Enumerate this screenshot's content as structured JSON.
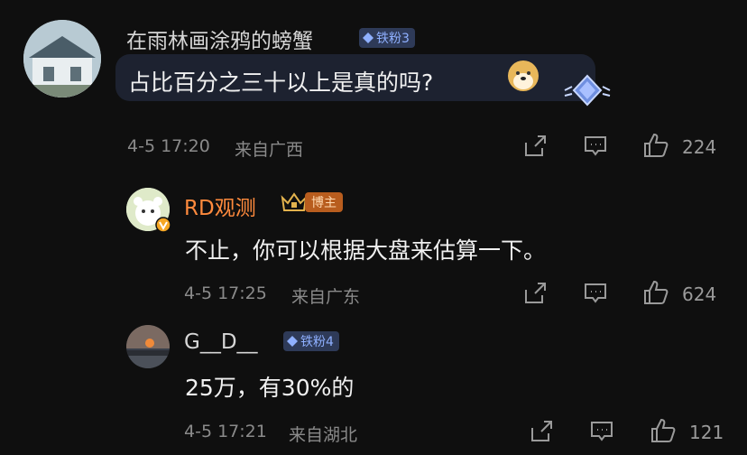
{
  "comments": [
    {
      "username": "在雨林画涂鸦的螃蟹",
      "fan_badge": "铁粉3",
      "text": "占比百分之三十以上是真的吗?",
      "time": "4-5 17:20",
      "location": "来自广西",
      "likes": "224"
    },
    {
      "username": "RD观测",
      "host_badge": "博主",
      "text": "不止，你可以根据大盘来估算一下。",
      "time": "4-5 17:25",
      "location": "来自广东",
      "likes": "624"
    },
    {
      "username": "G__D__",
      "fan_badge": "铁粉4",
      "text": "25万，有30%的",
      "time": "4-5 17:21",
      "location": "来自湖北",
      "likes": "121"
    }
  ],
  "colors": {
    "background": "#0f0f0f",
    "host_name": "#ff8a3d",
    "fan_badge": "#8fb0ff",
    "meta": "#8a8a8a"
  },
  "icons": [
    "share-icon",
    "comment-icon",
    "like-icon",
    "doge-emoji-icon",
    "diamond-bubble-icon",
    "crown-icon",
    "verified-v-icon"
  ]
}
